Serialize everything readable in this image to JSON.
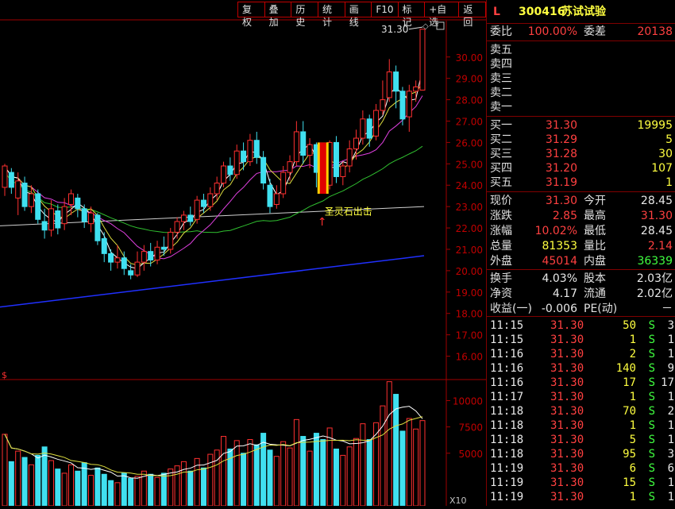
{
  "toolbar": [
    "复权",
    "叠加",
    "历史",
    "统计",
    "画线",
    "F10",
    "标记",
    "+自选",
    "返回"
  ],
  "header": {
    "flag": "L",
    "code": "300416",
    "name": "苏试试验"
  },
  "weibi": {
    "label1": "委比",
    "value1": "100.00%",
    "label2": "委差",
    "value2": "20138"
  },
  "sell": [
    {
      "label": "卖五",
      "price": "",
      "vol": ""
    },
    {
      "label": "卖四",
      "price": "",
      "vol": ""
    },
    {
      "label": "卖三",
      "price": "",
      "vol": ""
    },
    {
      "label": "卖二",
      "price": "",
      "vol": ""
    },
    {
      "label": "卖一",
      "price": "",
      "vol": ""
    }
  ],
  "buy": [
    {
      "label": "买一",
      "price": "31.30",
      "vol": "19995"
    },
    {
      "label": "买二",
      "price": "31.29",
      "vol": "5"
    },
    {
      "label": "买三",
      "price": "31.28",
      "vol": "30"
    },
    {
      "label": "买四",
      "price": "31.20",
      "vol": "107"
    },
    {
      "label": "买五",
      "price": "31.19",
      "vol": "1"
    }
  ],
  "quote": [
    {
      "l1": "现价",
      "v1": "31.30",
      "c1": "red",
      "l2": "今开",
      "v2": "28.45",
      "c2": "white"
    },
    {
      "l1": "涨跌",
      "v1": "2.85",
      "c1": "red",
      "l2": "最高",
      "v2": "31.30",
      "c2": "red"
    },
    {
      "l1": "涨幅",
      "v1": "10.02%",
      "c1": "red",
      "l2": "最低",
      "v2": "28.45",
      "c2": "white"
    },
    {
      "l1": "总量",
      "v1": "81353",
      "c1": "yellow",
      "l2": "量比",
      "v2": "2.14",
      "c2": "red"
    },
    {
      "l1": "外盘",
      "v1": "45014",
      "c1": "red",
      "l2": "内盘",
      "v2": "36339",
      "c2": "green"
    }
  ],
  "finance": [
    {
      "l1": "换手",
      "v1": "4.03%",
      "l2": "股本",
      "v2": "2.03亿"
    },
    {
      "l1": "净资",
      "v1": "4.17",
      "l2": "流通",
      "v2": "2.02亿"
    },
    {
      "l1": "收益(一)",
      "v1": "-0.006",
      "l2": "PE(动)",
      "v2": "－"
    }
  ],
  "ticks": [
    {
      "t": "11:15",
      "p": "31.30",
      "v": "50",
      "s": "S",
      "n": "3"
    },
    {
      "t": "11:15",
      "p": "31.30",
      "v": "1",
      "s": "S",
      "n": "1"
    },
    {
      "t": "11:16",
      "p": "31.30",
      "v": "2",
      "s": "S",
      "n": "1"
    },
    {
      "t": "11:16",
      "p": "31.30",
      "v": "140",
      "s": "S",
      "n": "9"
    },
    {
      "t": "11:16",
      "p": "31.30",
      "v": "17",
      "s": "S",
      "n": "17"
    },
    {
      "t": "11:17",
      "p": "31.30",
      "v": "1",
      "s": "S",
      "n": "1"
    },
    {
      "t": "11:18",
      "p": "31.30",
      "v": "70",
      "s": "S",
      "n": "2"
    },
    {
      "t": "11:18",
      "p": "31.30",
      "v": "1",
      "s": "S",
      "n": "1"
    },
    {
      "t": "11:18",
      "p": "31.30",
      "v": "5",
      "s": "S",
      "n": "1"
    },
    {
      "t": "11:18",
      "p": "31.30",
      "v": "95",
      "s": "S",
      "n": "3"
    },
    {
      "t": "11:19",
      "p": "31.30",
      "v": "6",
      "s": "S",
      "n": "6"
    },
    {
      "t": "11:19",
      "p": "31.30",
      "v": "15",
      "s": "S",
      "n": "1"
    },
    {
      "t": "11:19",
      "p": "31.30",
      "v": "1",
      "s": "S",
      "n": "1"
    }
  ],
  "chart_data": {
    "type": "candlestick",
    "price_ticks": [
      "30.00",
      "29.00",
      "28.00",
      "27.00",
      "26.00",
      "25.00",
      "24.00",
      "23.00",
      "22.00",
      "21.00",
      "20.00",
      "19.00",
      "18.00",
      "17.00",
      "16.00"
    ],
    "price_range": [
      15.5,
      31.7
    ],
    "volume_ticks": [
      "10000",
      "7500",
      "5000"
    ],
    "volume_range": [
      0,
      12000
    ],
    "volume_unit": "X10",
    "high_label": "31.30",
    "signal_label": "圣灵石出击",
    "candles": [
      [
        23.9,
        24.9,
        25.0,
        23.5
      ],
      [
        24.6,
        23.9,
        24.8,
        23.6
      ],
      [
        23.4,
        24.2,
        24.6,
        22.6
      ],
      [
        24.1,
        23.0,
        24.4,
        22.8
      ],
      [
        23.0,
        23.6,
        24.0,
        22.7
      ],
      [
        23.6,
        22.4,
        23.8,
        22.2
      ],
      [
        22.3,
        21.9,
        22.9,
        21.5
      ],
      [
        21.9,
        22.9,
        23.3,
        21.6
      ],
      [
        22.8,
        22.0,
        23.1,
        21.7
      ],
      [
        22.2,
        23.0,
        23.4,
        21.9
      ],
      [
        23.1,
        23.6,
        23.8,
        22.6
      ],
      [
        23.4,
        22.9,
        23.6,
        22.5
      ],
      [
        22.9,
        22.3,
        23.1,
        22.0
      ],
      [
        22.2,
        22.7,
        23.0,
        21.8
      ],
      [
        22.6,
        21.4,
        22.7,
        21.2
      ],
      [
        21.5,
        20.8,
        21.8,
        20.4
      ],
      [
        20.8,
        20.4,
        21.0,
        20.0
      ],
      [
        20.4,
        20.6,
        21.2,
        20.1
      ],
      [
        20.6,
        20.1,
        20.9,
        19.8
      ],
      [
        20.0,
        19.8,
        20.3,
        19.6
      ],
      [
        19.8,
        20.4,
        20.9,
        19.7
      ],
      [
        20.4,
        20.9,
        21.2,
        20.0
      ],
      [
        20.9,
        20.5,
        21.3,
        20.2
      ],
      [
        20.5,
        21.1,
        21.4,
        20.3
      ],
      [
        21.1,
        21.0,
        21.6,
        20.7
      ],
      [
        21.0,
        21.8,
        22.0,
        20.8
      ],
      [
        21.8,
        22.3,
        22.5,
        21.5
      ],
      [
        22.3,
        22.6,
        22.8,
        21.9
      ],
      [
        22.6,
        22.3,
        23.0,
        22.1
      ],
      [
        22.4,
        23.3,
        23.5,
        22.2
      ],
      [
        23.3,
        23.0,
        23.6,
        22.7
      ],
      [
        23.0,
        23.6,
        23.9,
        22.8
      ],
      [
        23.6,
        24.1,
        24.4,
        23.3
      ],
      [
        24.1,
        24.9,
        25.1,
        23.9
      ],
      [
        24.9,
        24.5,
        25.3,
        24.2
      ],
      [
        24.5,
        25.6,
        25.9,
        24.3
      ],
      [
        25.6,
        25.1,
        26.0,
        24.7
      ],
      [
        25.1,
        26.1,
        26.4,
        24.9
      ],
      [
        26.1,
        25.3,
        26.5,
        25.0
      ],
      [
        25.3,
        24.1,
        25.6,
        23.8
      ],
      [
        24.0,
        23.0,
        24.3,
        22.7
      ],
      [
        23.1,
        23.6,
        24.0,
        22.9
      ],
      [
        23.6,
        24.6,
        24.9,
        23.4
      ],
      [
        24.6,
        25.1,
        25.4,
        24.2
      ],
      [
        25.1,
        26.5,
        27.0,
        24.9
      ],
      [
        26.5,
        25.4,
        27.0,
        25.0
      ],
      [
        25.4,
        25.9,
        26.2,
        24.8
      ],
      [
        25.9,
        24.6,
        26.0,
        23.9
      ],
      [
        24.5,
        24.0,
        25.9,
        23.7
      ],
      [
        24.0,
        26.0,
        26.1,
        23.8
      ],
      [
        26.0,
        24.4,
        26.3,
        24.1
      ],
      [
        24.4,
        24.9,
        25.1,
        24.0
      ],
      [
        24.9,
        25.7,
        26.1,
        24.6
      ],
      [
        25.7,
        26.2,
        26.6,
        25.2
      ],
      [
        26.2,
        27.1,
        27.5,
        25.9
      ],
      [
        27.1,
        26.2,
        27.3,
        25.8
      ],
      [
        26.3,
        27.5,
        27.8,
        26.1
      ],
      [
        27.5,
        28.0,
        28.9,
        27.3
      ],
      [
        28.1,
        29.3,
        29.9,
        27.9
      ],
      [
        29.3,
        28.4,
        29.6,
        27.6
      ],
      [
        28.4,
        27.1,
        28.6,
        26.8
      ],
      [
        27.2,
        28.4,
        28.7,
        26.5
      ],
      [
        28.4,
        28.6,
        28.9,
        27.9
      ],
      [
        28.45,
        31.3,
        31.3,
        28.45
      ]
    ],
    "volumes": [
      [
        6800,
        1
      ],
      [
        4200,
        0
      ],
      [
        5200,
        1
      ],
      [
        4600,
        0
      ],
      [
        3900,
        1
      ],
      [
        4800,
        0
      ],
      [
        5600,
        0
      ],
      [
        4300,
        1
      ],
      [
        3500,
        0
      ],
      [
        3100,
        1
      ],
      [
        3900,
        1
      ],
      [
        3300,
        0
      ],
      [
        4100,
        0
      ],
      [
        2900,
        1
      ],
      [
        3600,
        0
      ],
      [
        3000,
        0
      ],
      [
        2400,
        0
      ],
      [
        2200,
        1
      ],
      [
        3100,
        0
      ],
      [
        2600,
        0
      ],
      [
        2800,
        1
      ],
      [
        3300,
        1
      ],
      [
        3000,
        0
      ],
      [
        2700,
        1
      ],
      [
        3100,
        0
      ],
      [
        3500,
        1
      ],
      [
        3800,
        1
      ],
      [
        4200,
        1
      ],
      [
        3300,
        0
      ],
      [
        4500,
        1
      ],
      [
        3600,
        0
      ],
      [
        4900,
        1
      ],
      [
        5300,
        1
      ],
      [
        6600,
        1
      ],
      [
        5400,
        0
      ],
      [
        6200,
        1
      ],
      [
        5000,
        0
      ],
      [
        6300,
        1
      ],
      [
        5800,
        0
      ],
      [
        6900,
        0
      ],
      [
        5300,
        0
      ],
      [
        4700,
        1
      ],
      [
        6100,
        1
      ],
      [
        5500,
        1
      ],
      [
        8200,
        1
      ],
      [
        6600,
        0
      ],
      [
        5200,
        1
      ],
      [
        6900,
        0
      ],
      [
        6300,
        0
      ],
      [
        7400,
        1
      ],
      [
        5400,
        0
      ],
      [
        4800,
        1
      ],
      [
        5600,
        1
      ],
      [
        6400,
        1
      ],
      [
        7800,
        1
      ],
      [
        6300,
        0
      ],
      [
        7900,
        1
      ],
      [
        9500,
        1
      ],
      [
        11800,
        1
      ],
      [
        10600,
        0
      ],
      [
        7100,
        0
      ],
      [
        8300,
        1
      ],
      [
        7300,
        1
      ],
      [
        8100,
        1
      ]
    ]
  }
}
